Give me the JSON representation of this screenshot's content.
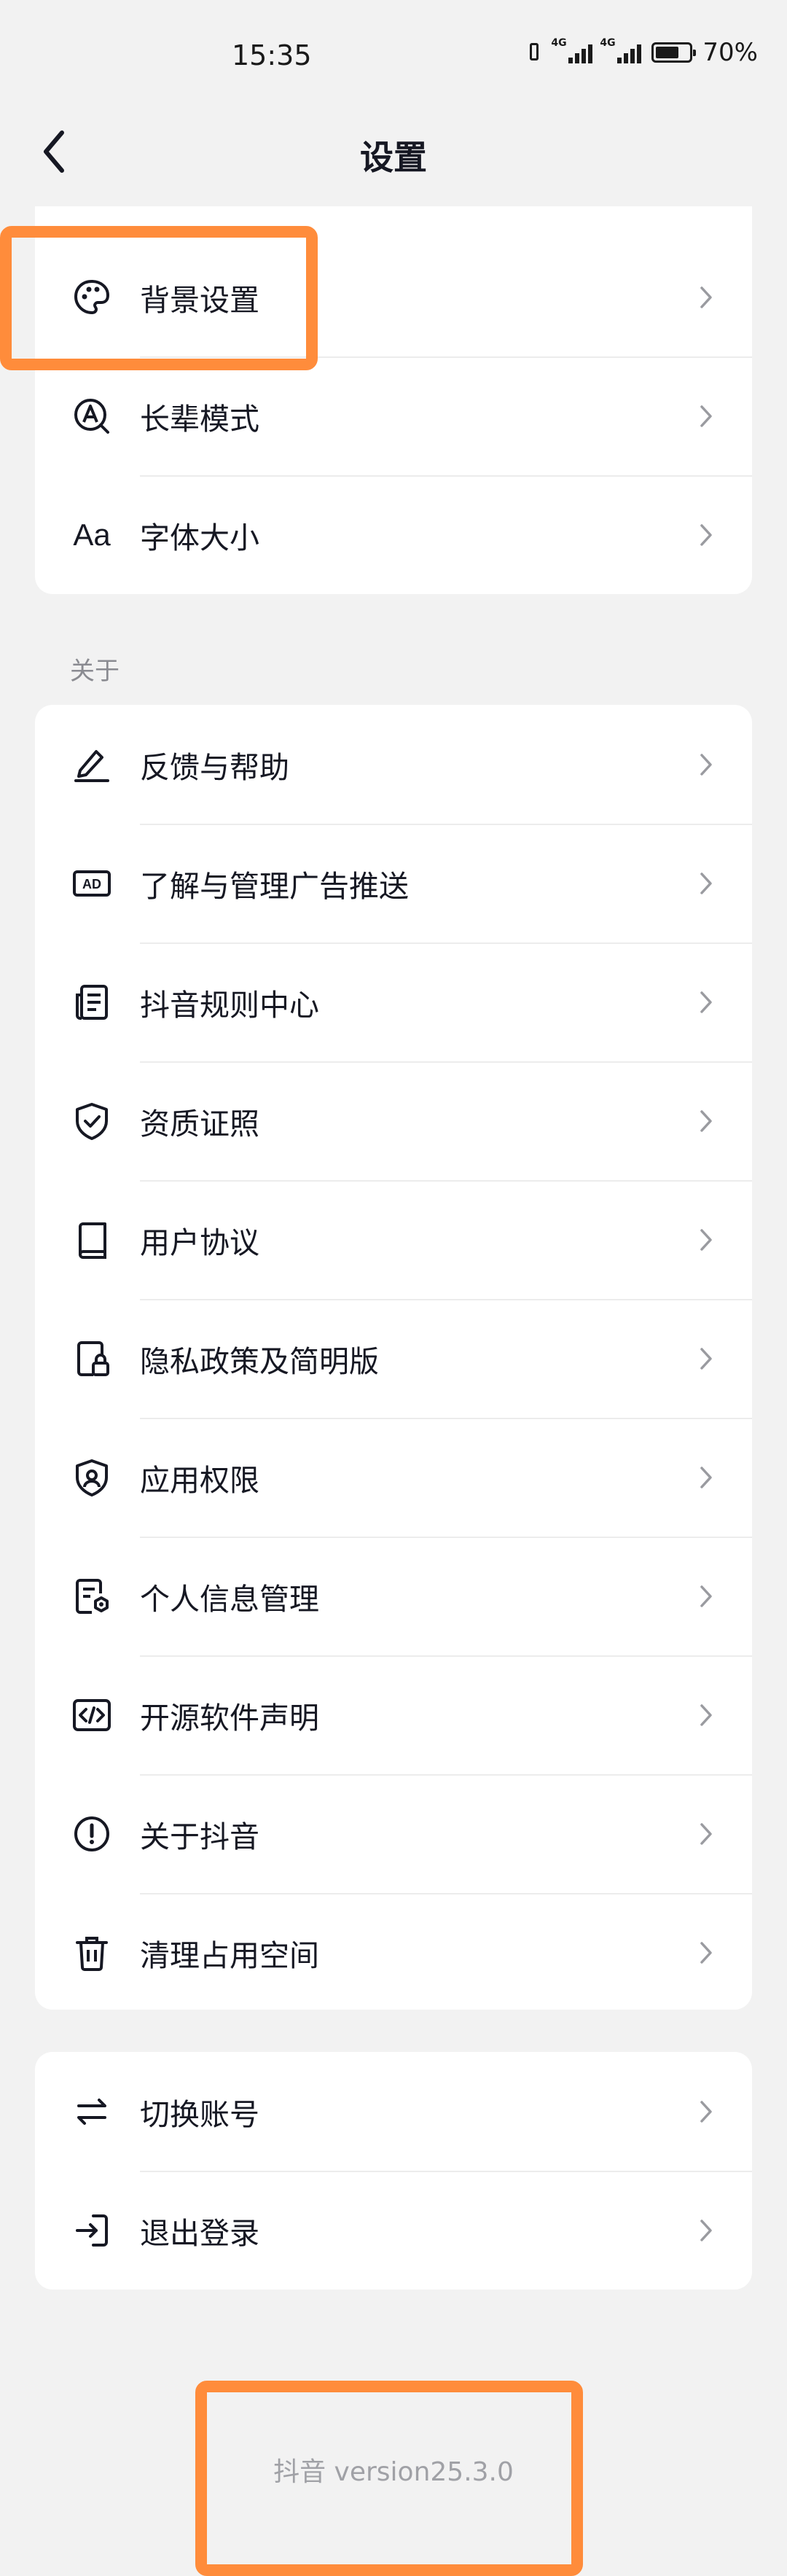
{
  "status": {
    "time": "15:35",
    "net1": "4G",
    "net2": "4G",
    "battery": "70%",
    "battery_level": 0.7
  },
  "header": {
    "title": "设置"
  },
  "card_display": {
    "items": [
      {
        "label": "背景设置",
        "icon": "palette-icon"
      },
      {
        "label": "长辈模式",
        "icon": "elder-mode-icon"
      },
      {
        "label": "字体大小",
        "icon": "font-size-icon",
        "glyph": "Aa"
      }
    ]
  },
  "section_about": {
    "label": "关于"
  },
  "card_about": {
    "items": [
      {
        "label": "反馈与帮助",
        "icon": "edit-icon"
      },
      {
        "label": "了解与管理广告推送",
        "icon": "ad-icon",
        "glyph": "AD"
      },
      {
        "label": "抖音规则中心",
        "icon": "document-list-icon"
      },
      {
        "label": "资质证照",
        "icon": "shield-check-icon"
      },
      {
        "label": "用户协议",
        "icon": "book-icon"
      },
      {
        "label": "隐私政策及简明版",
        "icon": "privacy-lock-icon"
      },
      {
        "label": "应用权限",
        "icon": "permission-shield-icon"
      },
      {
        "label": "个人信息管理",
        "icon": "personal-info-icon"
      },
      {
        "label": "开源软件声明",
        "icon": "code-icon"
      },
      {
        "label": "关于抖音",
        "icon": "info-icon"
      },
      {
        "label": "清理占用空间",
        "icon": "trash-icon"
      }
    ]
  },
  "card_account": {
    "items": [
      {
        "label": "切换账号",
        "icon": "switch-icon"
      },
      {
        "label": "退出登录",
        "icon": "logout-icon"
      }
    ]
  },
  "footer": {
    "version": "抖音 version25.3.0"
  },
  "colors": {
    "highlight": "#ff8c3b",
    "background": "#f2f2f2",
    "card": "#ffffff"
  }
}
